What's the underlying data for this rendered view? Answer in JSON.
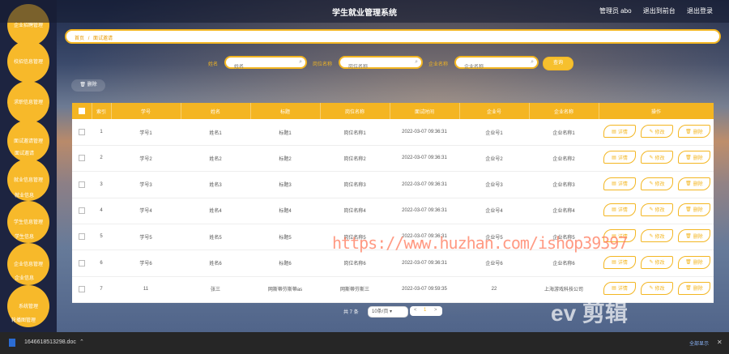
{
  "app": {
    "title": "学生就业管理系统"
  },
  "header": {
    "user": "管理员 abo",
    "back": "退出到前台",
    "logout": "退出登录"
  },
  "sidebar": {
    "items": [
      {
        "label": "企业招聘管理"
      },
      {
        "label": "校招信息管理"
      },
      {
        "label": "求职信息管理"
      },
      {
        "label": "面试邀请管理",
        "sub": "面试邀请"
      },
      {
        "label": "就业信息管理",
        "sub": "就业信息"
      },
      {
        "label": "学生信息管理",
        "sub": "学生信息"
      },
      {
        "label": "企业信息管理",
        "sub": "企业信息"
      },
      {
        "label": "系统管理",
        "sub": "轮播图管理"
      }
    ]
  },
  "breadcrumb": {
    "home": "首页",
    "sep": "/",
    "current": "面试邀请"
  },
  "search": {
    "name_label": "姓名",
    "name_placeholder": "姓名",
    "job_label": "岗位名称",
    "job_placeholder": "岗位名称",
    "company_label": "企业名称",
    "company_placeholder": "企业名称",
    "button": "查询"
  },
  "toolbar": {
    "delete": "删除"
  },
  "table": {
    "headers": [
      "索引",
      "学号",
      "姓名",
      "标题",
      "岗位名称",
      "面试时间",
      "企业号",
      "企业名称",
      "操作"
    ],
    "rows": [
      {
        "idx": "1",
        "sid": "学号1",
        "name": "姓名1",
        "title": "标题1",
        "job": "岗位名称1",
        "time": "2022-03-07 09:36:31",
        "cno": "企业号1",
        "cname": "企业名称1"
      },
      {
        "idx": "2",
        "sid": "学号2",
        "name": "姓名2",
        "title": "标题2",
        "job": "岗位名称2",
        "time": "2022-03-07 09:36:31",
        "cno": "企业号2",
        "cname": "企业名称2"
      },
      {
        "idx": "3",
        "sid": "学号3",
        "name": "姓名3",
        "title": "标题3",
        "job": "岗位名称3",
        "time": "2022-03-07 09:36:31",
        "cno": "企业号3",
        "cname": "企业名称3"
      },
      {
        "idx": "4",
        "sid": "学号4",
        "name": "姓名4",
        "title": "标题4",
        "job": "岗位名称4",
        "time": "2022-03-07 09:36:31",
        "cno": "企业号4",
        "cname": "企业名称4"
      },
      {
        "idx": "5",
        "sid": "学号5",
        "name": "姓名5",
        "title": "标题5",
        "job": "岗位名称5",
        "time": "2022-03-07 09:36:31",
        "cno": "企业号5",
        "cname": "企业名称5"
      },
      {
        "idx": "6",
        "sid": "学号6",
        "name": "姓名6",
        "title": "标题6",
        "job": "岗位名称6",
        "time": "2022-03-07 09:36:31",
        "cno": "企业号6",
        "cname": "企业名称6"
      },
      {
        "idx": "7",
        "sid": "11",
        "name": "张三",
        "title": "网斯蒂芬斯蒂as",
        "job": "网斯蒂芬斯三",
        "time": "2022-03-07 09:59:35",
        "cno": "22",
        "cname": "上海游戏科技公司"
      }
    ],
    "actions": {
      "detail": "详情",
      "edit": "修改",
      "delete": "删除"
    }
  },
  "pager": {
    "total": "共 7 条",
    "size": "10条/页",
    "page": "1",
    "prev": "<",
    "next": ">"
  },
  "watermark": "https://www.huzhan.com/ishop39397",
  "logo_text": "ev 剪辑",
  "downloads": {
    "file": "1646618513298.doc",
    "show_all": "全部显示"
  },
  "colors": {
    "accent": "#f4b522"
  }
}
